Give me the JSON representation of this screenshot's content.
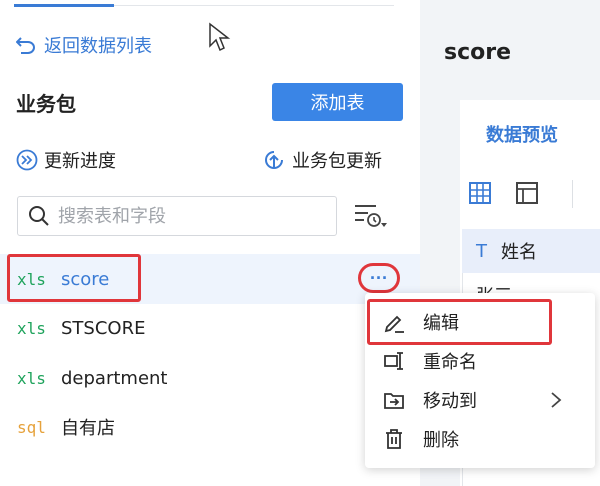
{
  "nav": {
    "back_label": "返回数据列表"
  },
  "package": {
    "title": "业务包",
    "add_table_label": "添加表",
    "update_progress_label": "更新进度",
    "package_update_label": "业务包更新"
  },
  "search": {
    "placeholder": "搜索表和字段"
  },
  "tables": [
    {
      "type": "xls",
      "name": "score"
    },
    {
      "type": "xls",
      "name": "STSCORE"
    },
    {
      "type": "xls",
      "name": "department"
    },
    {
      "type": "sql",
      "name": "自有店"
    }
  ],
  "more_button": {
    "label": "···"
  },
  "context_menu": {
    "items": [
      {
        "label": "编辑",
        "icon": "pencil-icon"
      },
      {
        "label": "重命名",
        "icon": "rename-icon"
      },
      {
        "label": "移动到",
        "icon": "move-to-folder-icon"
      },
      {
        "label": "删除",
        "icon": "trash-icon"
      }
    ]
  },
  "preview": {
    "table_title": "score",
    "tab_label": "数据预览",
    "column_type": "T",
    "column_name": "姓名",
    "first_cell": "张三"
  },
  "colors": {
    "accent": "#3a7bd5",
    "highlight": "#e0363b",
    "xls": "#1fa35c",
    "sql": "#e6a23c"
  }
}
